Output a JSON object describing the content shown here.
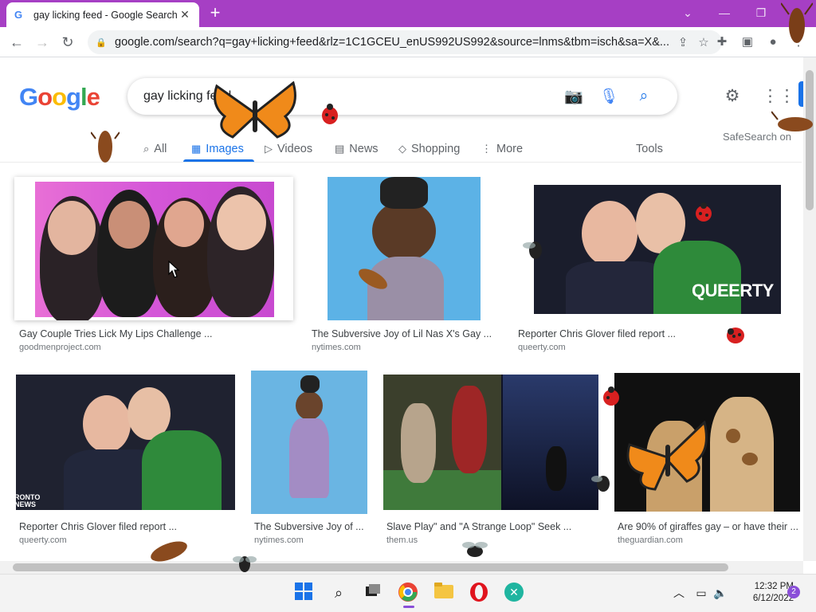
{
  "browser": {
    "tab_title": "gay licking feed - Google Search",
    "url": "google.com/search?q=gay+licking+feed&rlz=1C1GCEU_enUS992US992&source=lnms&tbm=isch&sa=X&..."
  },
  "google": {
    "logo": "Google",
    "query": "gay licking feed",
    "tabs": [
      {
        "label": "All",
        "icon": "search-icon"
      },
      {
        "label": "Images",
        "icon": "image-icon",
        "active": true
      },
      {
        "label": "Videos",
        "icon": "video-icon"
      },
      {
        "label": "News",
        "icon": "news-icon"
      },
      {
        "label": "Shopping",
        "icon": "tag-icon"
      },
      {
        "label": "More",
        "icon": "more-vert-icon"
      }
    ],
    "tools": "Tools",
    "safesearch": "SafeSearch on"
  },
  "results": [
    {
      "caption": "Gay Couple Tries Lick My Lips Challenge ...",
      "source": "goodmenproject.com"
    },
    {
      "caption": "The Subversive Joy of Lil Nas X's Gay ...",
      "source": "nytimes.com"
    },
    {
      "caption": "Reporter Chris Glover filed report ...",
      "source": "queerty.com",
      "overlay": "QUEERTY"
    },
    {
      "caption": "Reporter Chris Glover filed report ...",
      "source": "queerty.com",
      "overlay": "RONTO NEWS"
    },
    {
      "caption": "The Subversive Joy of ...",
      "source": "nytimes.com"
    },
    {
      "caption": "Slave Play\" and \"A Strange Loop\" Seek ...",
      "source": "them.us"
    },
    {
      "caption": "Are 90% of giraffes gay – or have their ...",
      "source": "theguardian.com"
    }
  ],
  "taskbar": {
    "time": "12:32 PM",
    "date": "6/12/2022",
    "notifications": "2"
  },
  "colors": {
    "tab_bar": "#a63fc4",
    "accent": "#1a73e8"
  }
}
